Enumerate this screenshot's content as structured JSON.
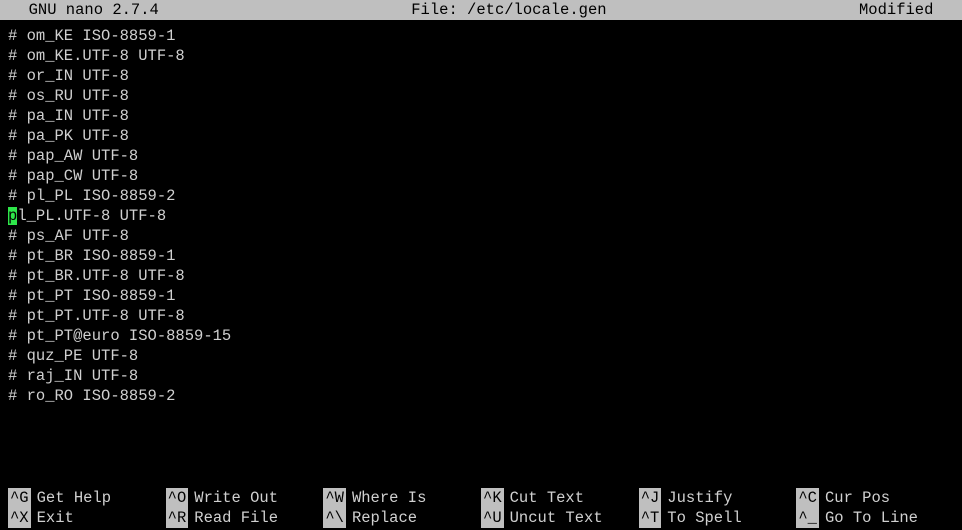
{
  "header": {
    "app": "  GNU nano 2.7.4",
    "file": "File: /etc/locale.gen",
    "status": "Modified  "
  },
  "lines": [
    "# om_KE ISO-8859-1",
    "# om_KE.UTF-8 UTF-8",
    "# or_IN UTF-8",
    "# os_RU UTF-8",
    "# pa_IN UTF-8",
    "# pa_PK UTF-8",
    "# pap_AW UTF-8",
    "# pap_CW UTF-8",
    "# pl_PL ISO-8859-2"
  ],
  "cursor_line": {
    "cursor_char": "p",
    "rest": "l_PL.UTF-8 UTF-8"
  },
  "lines_after": [
    "# ps_AF UTF-8",
    "# pt_BR ISO-8859-1",
    "# pt_BR.UTF-8 UTF-8",
    "# pt_PT ISO-8859-1",
    "# pt_PT.UTF-8 UTF-8",
    "# pt_PT@euro ISO-8859-15",
    "# quz_PE UTF-8",
    "# raj_IN UTF-8",
    "# ro_RO ISO-8859-2"
  ],
  "shortcuts": [
    [
      {
        "key": "^G",
        "label": "Get Help"
      },
      {
        "key": "^O",
        "label": "Write Out"
      },
      {
        "key": "^W",
        "label": "Where Is"
      },
      {
        "key": "^K",
        "label": "Cut Text"
      },
      {
        "key": "^J",
        "label": "Justify"
      },
      {
        "key": "^C",
        "label": "Cur Pos"
      }
    ],
    [
      {
        "key": "^X",
        "label": "Exit"
      },
      {
        "key": "^R",
        "label": "Read File"
      },
      {
        "key": "^\\",
        "label": "Replace"
      },
      {
        "key": "^U",
        "label": "Uncut Text"
      },
      {
        "key": "^T",
        "label": "To Spell"
      },
      {
        "key": "^_",
        "label": "Go To Line"
      }
    ]
  ]
}
